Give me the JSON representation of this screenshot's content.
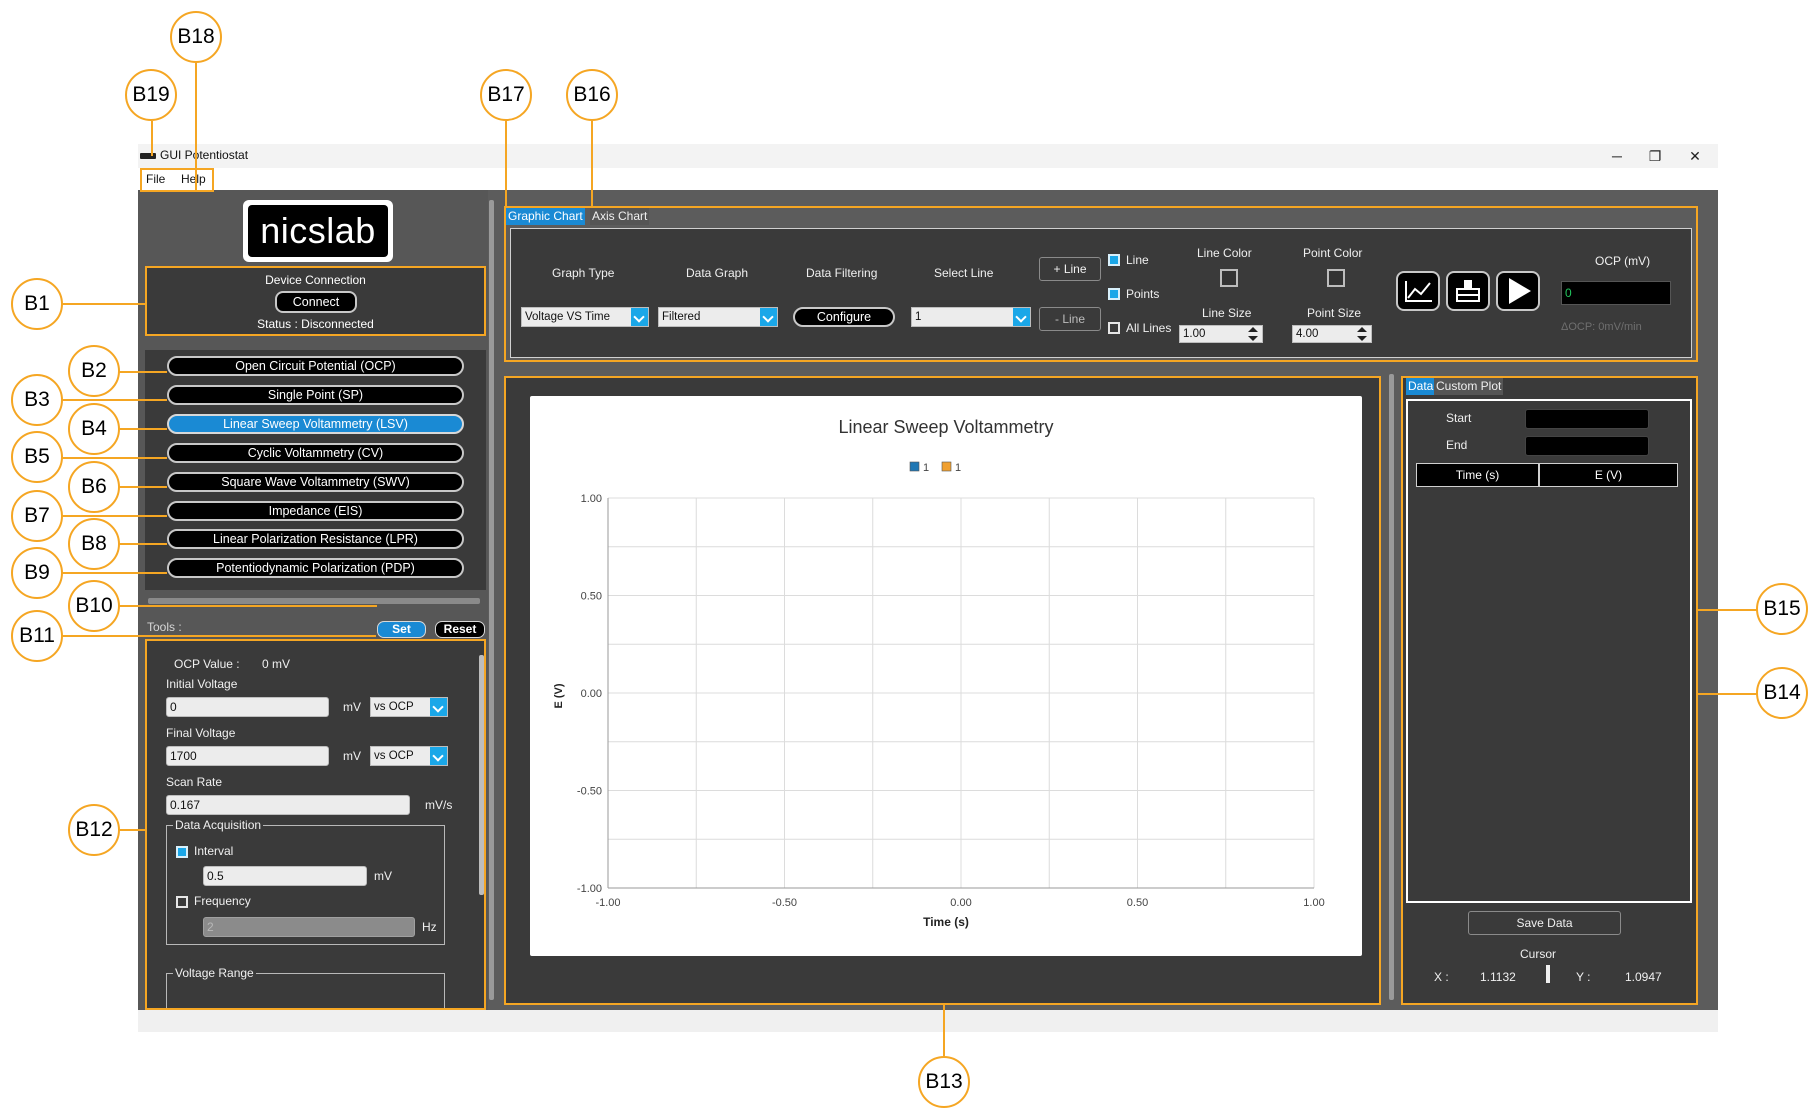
{
  "window": {
    "title": "GUI Potentiostat",
    "minimize_glyph": "─",
    "maximize_glyph": "❐",
    "close_glyph": "✕"
  },
  "menu": {
    "file": "File",
    "help": "Help"
  },
  "logo": {
    "text": "nicslab"
  },
  "device": {
    "heading": "Device Connection",
    "connect_label": "Connect",
    "status": "Status : Disconnected"
  },
  "methods": [
    {
      "label": "Open Circuit Potential (OCP)",
      "active": false
    },
    {
      "label": "Single Point (SP)",
      "active": false
    },
    {
      "label": "Linear Sweep Voltammetry (LSV)",
      "active": true
    },
    {
      "label": "Cyclic Voltammetry (CV)",
      "active": false
    },
    {
      "label": "Square Wave Voltammetry (SWV)",
      "active": false
    },
    {
      "label": "Impedance (EIS)",
      "active": false
    },
    {
      "label": "Linear Polarization Resistance (LPR)",
      "active": false
    },
    {
      "label": "Potentiodynamic Polarization (PDP)",
      "active": false
    }
  ],
  "tools": {
    "label": "Tools :",
    "set_label": "Set",
    "reset_label": "Reset"
  },
  "params": {
    "ocp_value_label": "OCP Value :",
    "ocp_value": "0 mV",
    "initial_voltage_label": "Initial Voltage",
    "initial_voltage_value": "0",
    "initial_voltage_unit": "mV",
    "initial_voltage_ref": "vs OCP",
    "final_voltage_label": "Final Voltage",
    "final_voltage_value": "1700",
    "final_voltage_unit": "mV",
    "final_voltage_ref": "vs OCP",
    "scan_rate_label": "Scan Rate",
    "scan_rate_value": "0.167",
    "scan_rate_unit": "mV/s",
    "data_acquisition_label": "Data Acquisition",
    "interval_label": "Interval",
    "interval_checked": true,
    "interval_value": "0.5",
    "interval_unit": "mV",
    "frequency_label": "Frequency",
    "frequency_checked": false,
    "frequency_value": "2",
    "frequency_unit": "Hz",
    "voltage_range_label": "Voltage Range"
  },
  "toolbar": {
    "tabs": [
      {
        "label": "Graphic Chart",
        "active": true
      },
      {
        "label": "Axis Chart",
        "active": false
      }
    ],
    "graph_type_label": "Graph Type",
    "graph_type_value": "Voltage VS Time",
    "data_graph_label": "Data Graph",
    "data_graph_value": "Filtered",
    "data_filtering_label": "Data Filtering",
    "configure_label": "Configure",
    "select_line_label": "Select Line",
    "select_line_value": "1",
    "add_line_label": "+ Line",
    "remove_line_label": "- Line",
    "line_label": "Line",
    "line_checked": true,
    "points_label": "Points",
    "points_checked": true,
    "all_lines_label": "All Lines",
    "all_lines_checked": false,
    "line_color_label": "Line Color",
    "point_color_label": "Point Color",
    "line_size_label": "Line Size",
    "line_size_value": "1.00",
    "point_size_label": "Point Size",
    "point_size_value": "4.00",
    "ocp_label": "OCP (mV)",
    "ocp_value": "0",
    "delta_ocp": "ΔOCP: 0mV/min",
    "icons": [
      "chart-line-icon",
      "clear-icon",
      "play-icon"
    ]
  },
  "chart_data": {
    "type": "line",
    "title": "Linear Sweep Voltammetry",
    "xlabel": "Time (s)",
    "ylabel": "E (V)",
    "xlim": [
      -1.0,
      1.0
    ],
    "ylim": [
      -1.0,
      1.0
    ],
    "x_ticks": [
      "-1.00",
      "-0.50",
      "0.00",
      "0.50",
      "1.00"
    ],
    "y_ticks": [
      "1.00",
      "0.50",
      "0.00",
      "-0.50",
      "-1.00"
    ],
    "grid": true,
    "legend_position": "top-center",
    "series": [
      {
        "name": "1",
        "color": "#1f77b4",
        "values": []
      },
      {
        "name": "1",
        "color": "#f0a030",
        "values": []
      }
    ]
  },
  "data_panel": {
    "tabs": [
      {
        "label": "Data",
        "active": true
      },
      {
        "label": "Custom Plot",
        "active": false
      }
    ],
    "start_label": "Start",
    "end_label": "End",
    "columns": [
      "Time (s)",
      "E (V)"
    ],
    "save_label": "Save Data",
    "cursor_label": "Cursor",
    "cursor_x_label": "X :",
    "cursor_x": "1.1132",
    "cursor_y_label": "Y :",
    "cursor_y": "1.0947"
  },
  "callouts": [
    "B1",
    "B2",
    "B3",
    "B4",
    "B5",
    "B6",
    "B7",
    "B8",
    "B9",
    "B10",
    "B11",
    "B12",
    "B13",
    "B14",
    "B15",
    "B16",
    "B17",
    "B18",
    "B19"
  ],
  "colors": {
    "accent": "#f5a623",
    "active_blue": "#1a8ad4",
    "panel": "#3a3a3a"
  }
}
